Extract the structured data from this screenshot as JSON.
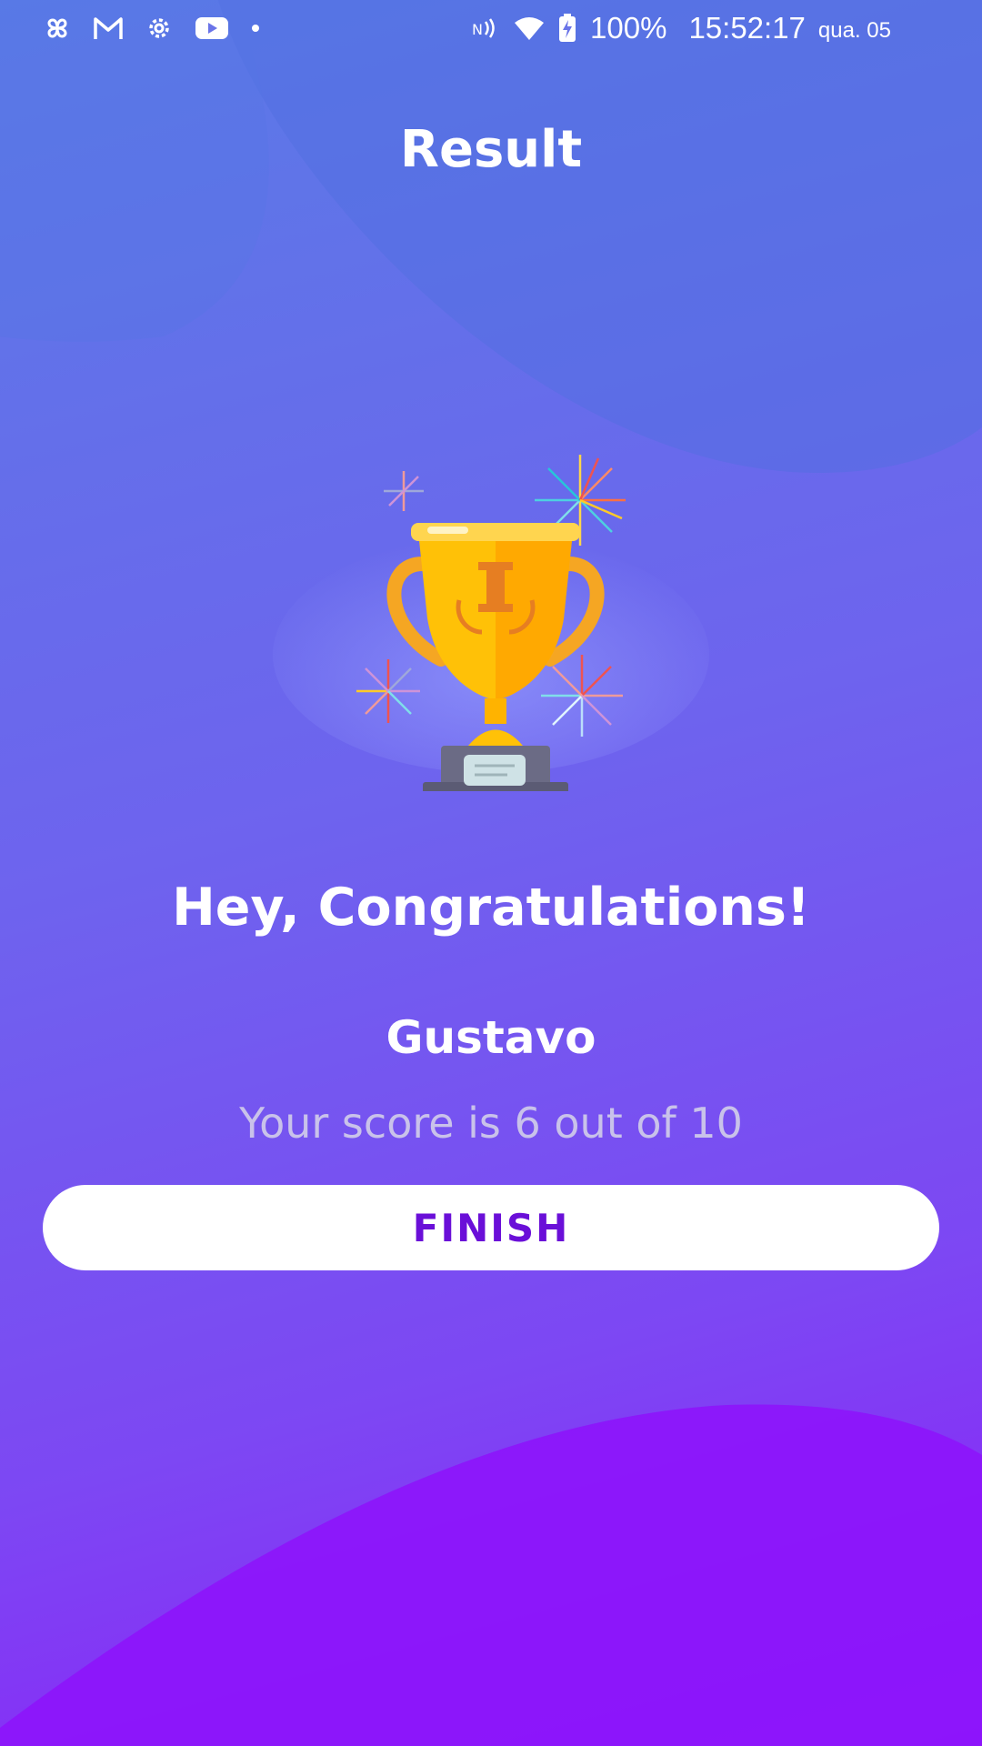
{
  "status_bar": {
    "icons": [
      "pinwheel-icon",
      "gmail-icon",
      "settings-icon",
      "youtube-icon",
      "dot-icon",
      "nfc-icon",
      "wifi-icon",
      "battery-charging-icon"
    ],
    "battery": "100%",
    "time": "15:52:17",
    "date": "qua. 05"
  },
  "header": {
    "title": "Result"
  },
  "result": {
    "illustration": "trophy-icon",
    "congrats": "Hey, Congratulations!",
    "name": "Gustavo",
    "score_text": "Your score is 6 out of 10",
    "score": 6,
    "total": 10
  },
  "actions": {
    "finish_label": "FINISH"
  },
  "colors": {
    "accent": "#6a0fd8",
    "bg_top": "#5a7be6",
    "bg_bottom": "#8c1cf8"
  }
}
